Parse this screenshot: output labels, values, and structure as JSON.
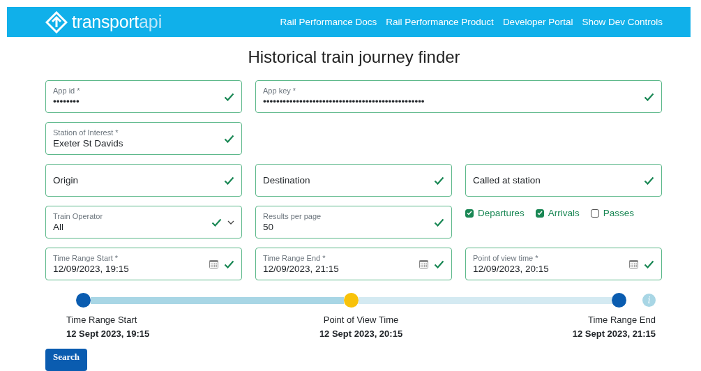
{
  "header": {
    "logo": {
      "word": "transport",
      "suffix": "api"
    },
    "links": [
      "Rail Performance Docs",
      "Rail Performance Product",
      "Developer Portal",
      "Show Dev Controls"
    ]
  },
  "title": "Historical train journey finder",
  "rows": [
    [
      {
        "kind": "text",
        "label": "App id *",
        "value": "••••••••",
        "valid": true
      },
      {
        "kind": "text",
        "label": "App key *",
        "value": "•••••••••••••••••••••••••••••••••••••••••••••••••",
        "valid": true
      }
    ],
    [
      {
        "kind": "text",
        "label": "Station of Interest *",
        "value": "Exeter St Davids",
        "valid": true
      }
    ],
    [
      {
        "kind": "placeholder",
        "placeholder": "Origin",
        "valid": true
      },
      {
        "kind": "placeholder",
        "placeholder": "Destination",
        "valid": true
      },
      {
        "kind": "placeholder",
        "placeholder": "Called at station",
        "valid": true
      }
    ],
    [
      {
        "kind": "select",
        "label": "Train Operator",
        "value": "All",
        "valid": true
      },
      {
        "kind": "text",
        "label": "Results per page",
        "value": "50",
        "valid": true
      },
      {
        "kind": "checkboxes",
        "items": [
          {
            "label": "Departures",
            "checked": true
          },
          {
            "label": "Arrivals",
            "checked": true
          },
          {
            "label": "Passes",
            "checked": false
          }
        ]
      }
    ],
    [
      {
        "kind": "date",
        "label": "Time Range Start *",
        "value": "12/09/2023, 19:15",
        "valid": true
      },
      {
        "kind": "date",
        "label": "Time Range End *",
        "value": "12/09/2023, 21:15",
        "valid": true
      },
      {
        "kind": "date",
        "label": "Point of view time *",
        "value": "12/09/2023, 20:15",
        "valid": true
      }
    ]
  ],
  "timeline": {
    "info_icon": "i",
    "stops": [
      {
        "label": "Time Range Start",
        "time": "12 Sept 2023, 19:15"
      },
      {
        "label": "Point of View Time",
        "time": "12 Sept 2023, 20:15"
      },
      {
        "label": "Time Range End",
        "time": "12 Sept 2023, 21:15"
      }
    ]
  },
  "search_button": "Search"
}
